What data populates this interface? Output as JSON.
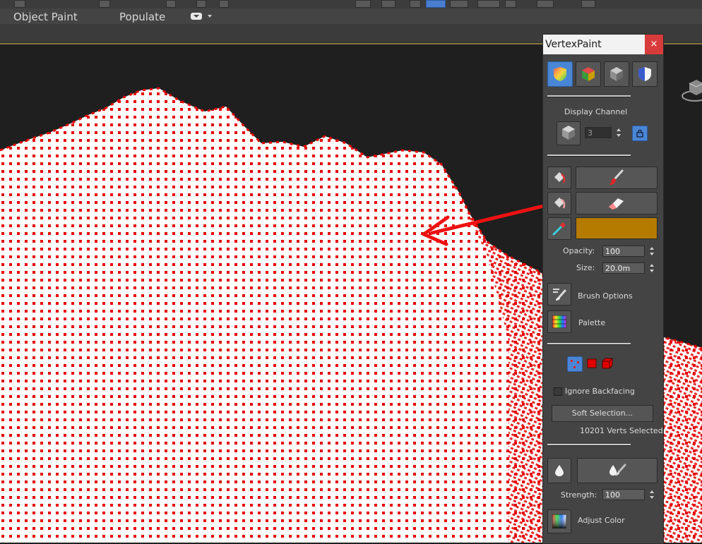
{
  "ribbon": {
    "tabs": [
      "Object Paint",
      "Populate"
    ]
  },
  "vertex_paint": {
    "title": "VertexPaint",
    "close_label": "×",
    "display_channel_label": "Display Channel",
    "channel_value": "3",
    "opacity_label": "Opacity:",
    "opacity_value": "100",
    "size_label": "Size:",
    "size_value": "20.0m",
    "paint_color": "#b57a00",
    "brush_options_label": "Brush Options",
    "palette_label": "Palette",
    "ignore_backfacing_label": "Ignore Backfacing",
    "soft_selection_label": "Soft Selection...",
    "verts_selected": "10201 Verts Selected",
    "strength_label": "Strength:",
    "strength_value": "100",
    "adjust_color_label": "Adjust Color"
  },
  "colors": {
    "accent": "#4a86d6",
    "vertex_red": "#e60000",
    "arrow_red": "#ee1111",
    "close_red": "#d83b3b"
  },
  "icons": {
    "mode_buttons": [
      "paint-mode-icon",
      "color-mode-icon",
      "gray-mode-icon",
      "shield-mode-icon"
    ],
    "selection_modes": [
      "vertex-select-icon",
      "face-select-icon",
      "element-select-icon"
    ]
  }
}
